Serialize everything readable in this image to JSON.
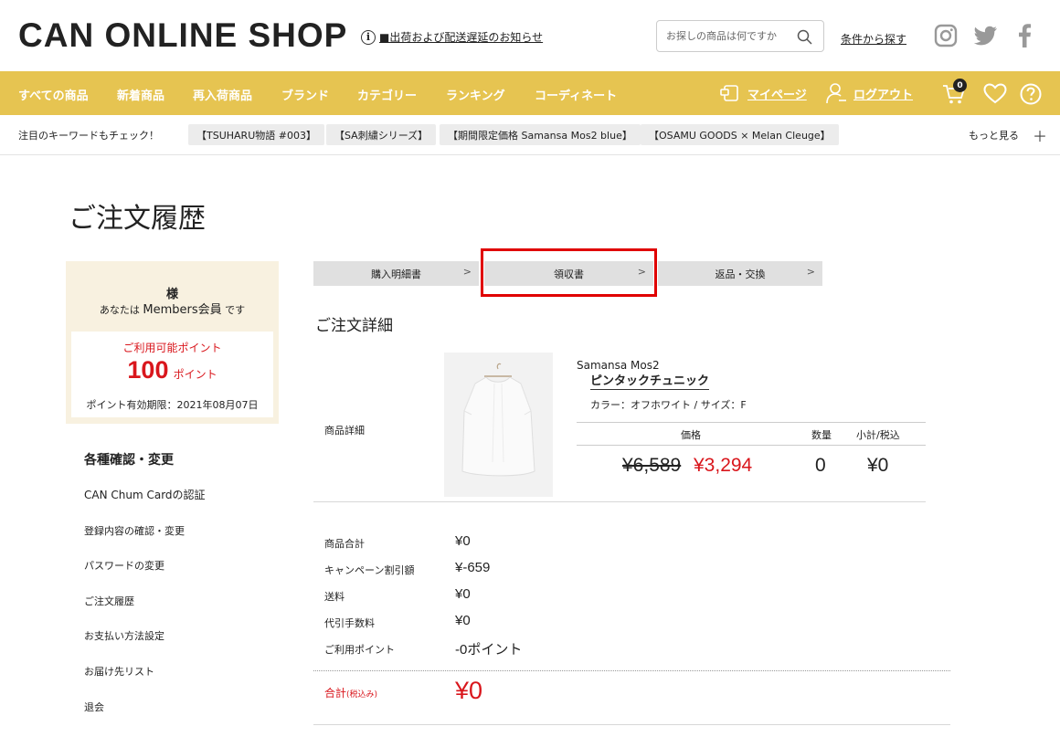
{
  "header": {
    "logo": "CAN ONLINE SHOP",
    "notice": "■出荷および配送遅延のお知らせ",
    "search_placeholder": "お探しの商品は何ですか",
    "cond_search": "条件から探す"
  },
  "nav": {
    "items": [
      "すべての商品",
      "新着商品",
      "再入荷商品",
      "ブランド",
      "カテゴリー",
      "ランキング",
      "コーディネート"
    ],
    "mypage": "マイページ",
    "logout": "ログアウト",
    "cart_count": "0"
  },
  "keywords": {
    "label": "注目のキーワードもチェック！",
    "chips": [
      "【TSUHARU物語 #003】",
      "【SA刺繍シリーズ】",
      "【期間限定価格 Samansa Mos2 blue】",
      "【OSAMU GOODS × Melan Cleuge】"
    ],
    "more": "もっと見る",
    "plus": "＋"
  },
  "page_title": "ご注文履歴",
  "member": {
    "name": "様",
    "rank_prefix": "あなたは",
    "rank": "Members会員",
    "rank_suffix": "です",
    "points_title": "ご利用可能ポイント",
    "points": "100",
    "points_unit": "ポイント",
    "expiry": "ポイント有効期限：2021年08月07日"
  },
  "side": {
    "heading": "各種確認・変更",
    "items": [
      "CAN Chum Cardの認証",
      "登録内容の確認・変更",
      "パスワードの変更",
      "ご注文履歴",
      "お支払い方法設定",
      "お届け先リスト",
      "退会"
    ]
  },
  "tabs": [
    "購入明細書",
    "領収書",
    "返品・交換"
  ],
  "order": {
    "section_title": "ご注文詳細",
    "product_label": "商品詳細",
    "brand": "Samansa Mos2",
    "name": "ピンタックチュニック",
    "attributes": "カラー：オフホワイト / サイズ：F",
    "head_price": "価格",
    "head_qty": "数量",
    "head_subtotal": "小計/税込",
    "old_price": "¥6,589",
    "new_price": "¥3,294",
    "qty": "0",
    "subtotal": "¥0"
  },
  "summary": {
    "rows": [
      {
        "label": "商品合計",
        "value": "¥0"
      },
      {
        "label": "キャンペーン割引額",
        "value": "¥-659"
      },
      {
        "label": "送料",
        "value": "¥0"
      },
      {
        "label": "代引手数料",
        "value": "¥0"
      },
      {
        "label": "ご利用ポイント",
        "value": "-0ポイント"
      }
    ],
    "total_label": "合計",
    "total_note": "(税込み)",
    "total_value": "¥0"
  },
  "colors": {
    "accent": "#e6c451",
    "sale_red": "#d9161c",
    "highlight": "#e00000"
  }
}
